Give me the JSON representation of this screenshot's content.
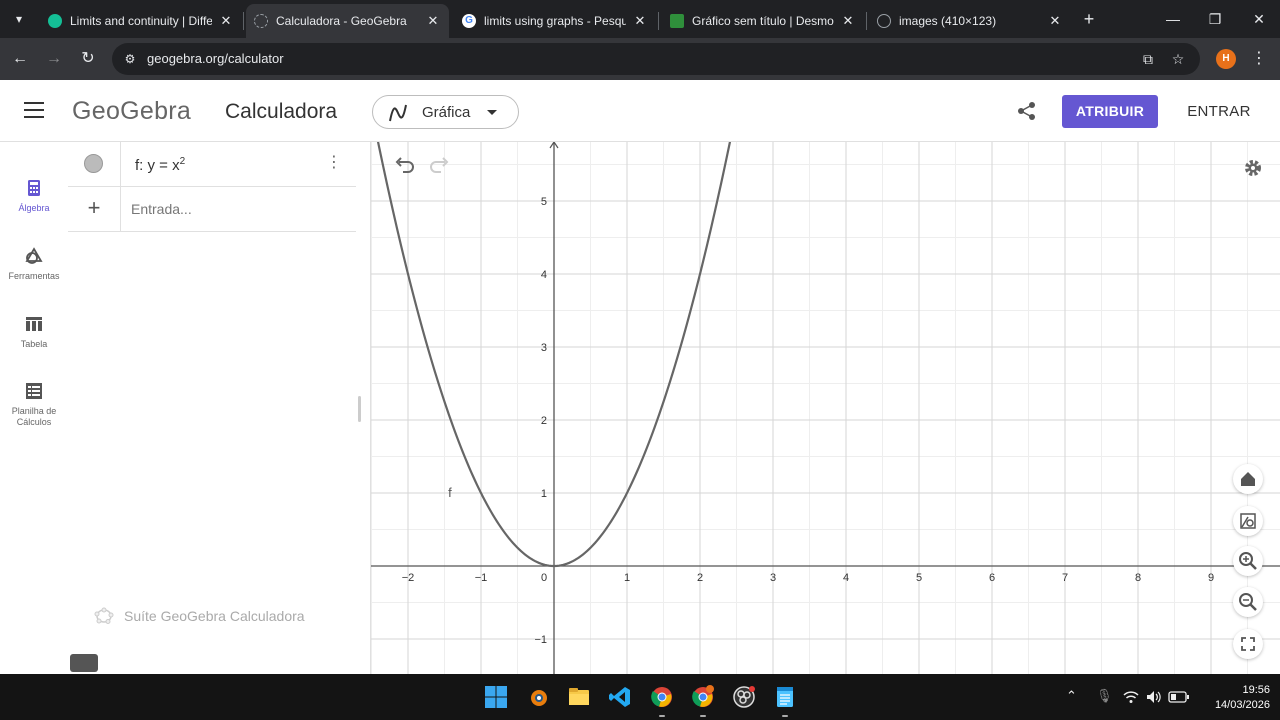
{
  "browser": {
    "tabs": [
      {
        "title": "Limits and continuity | Differ",
        "favicon_color": "#14bf96",
        "active": false
      },
      {
        "title": "Calculadora - GeoGebra",
        "favicon_color": "#9aa0a6",
        "active": true
      },
      {
        "title": "limits using graphs - Pesquis",
        "favicon_color": "#4285f4",
        "active": false
      },
      {
        "title": "Gráfico sem título | Desmos",
        "favicon_color": "#2f8f3b",
        "active": false
      },
      {
        "title": "images (410×123)",
        "favicon_color": "#9aa0a6",
        "active": false
      }
    ],
    "url": "geogebra.org/calculator",
    "profile_initial": "H"
  },
  "header": {
    "logo": "GeoGebra",
    "app_title": "Calculadora",
    "mode_label": "Gráfica",
    "signin_label": "ATRIBUIR",
    "login_label": "ENTRAR",
    "accent_color": "#6557d2"
  },
  "sidenav": {
    "items": [
      {
        "label": "Álgebra",
        "icon": "calculator-icon",
        "active": true
      },
      {
        "label": "Ferramentas",
        "icon": "shapes-icon",
        "active": false
      },
      {
        "label": "Tabela",
        "icon": "table-icon",
        "active": false
      },
      {
        "label": "Planilha de Cálculos",
        "icon": "spreadsheet-icon",
        "active": false
      }
    ]
  },
  "algebra": {
    "expression_prefix": "f: y = x",
    "expression_exponent": "2",
    "input_placeholder": "Entrada...",
    "suite_label": "Suíte GeoGebra Calculadora"
  },
  "graph": {
    "function": "y = x^2",
    "function_label": "f",
    "curve_color": "#666666",
    "x_ticks": [
      -2,
      -1,
      0,
      1,
      2,
      3,
      4,
      5,
      6,
      7,
      8,
      9
    ],
    "y_ticks": [
      5,
      4,
      3,
      2,
      1,
      -1
    ],
    "x_visible_range": [
      -2.5,
      9.5
    ],
    "y_visible_range": [
      -1.5,
      5.8
    ],
    "grid": true
  },
  "taskbar": {
    "time": "19:56",
    "date": "14/03/2026"
  }
}
